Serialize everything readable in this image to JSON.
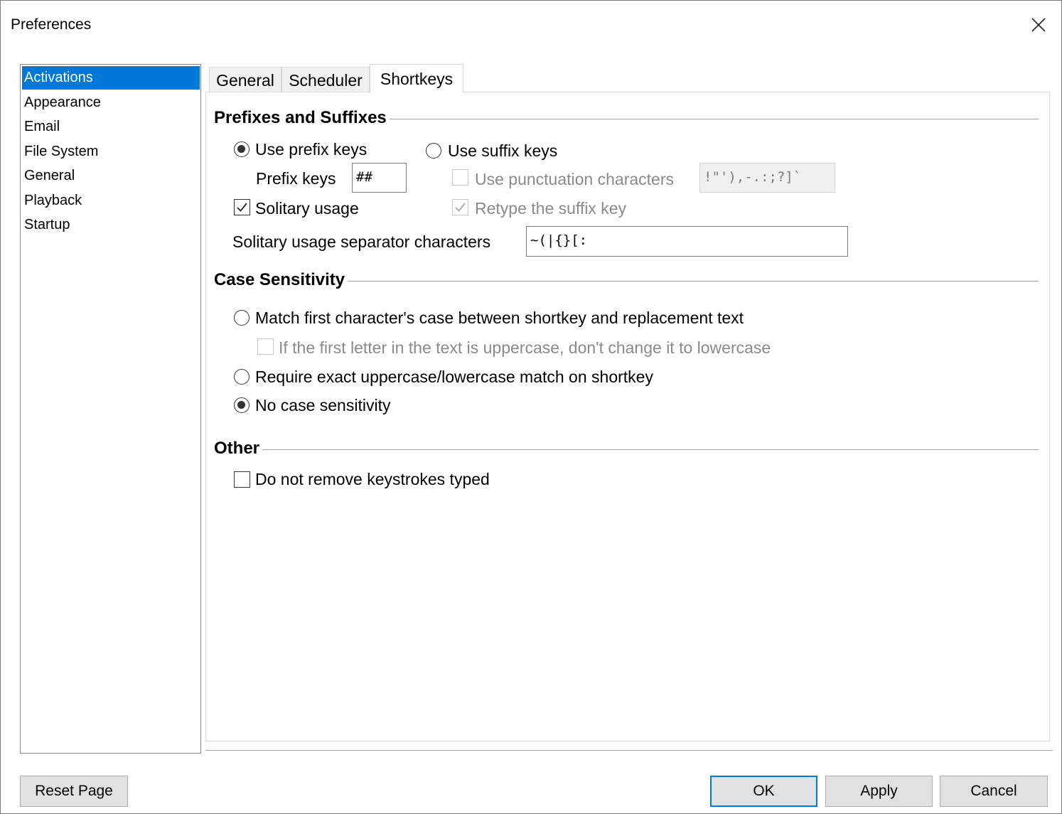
{
  "window": {
    "title": "Preferences"
  },
  "categories": [
    "Activations",
    "Appearance",
    "Email",
    "File System",
    "General",
    "Playback",
    "Startup"
  ],
  "selected_category": "Activations",
  "tabs": [
    "General",
    "Scheduler",
    "Shortkeys"
  ],
  "active_tab": "Shortkeys",
  "prefixes": {
    "title": "Prefixes and Suffixes",
    "use_prefix_label": "Use prefix keys",
    "use_prefix_selected": true,
    "use_suffix_label": "Use suffix keys",
    "use_suffix_selected": false,
    "prefix_keys_label": "Prefix keys",
    "prefix_keys_value": "##",
    "punctuation_label": "Use punctuation characters",
    "punctuation_value": "!\"'),-.:;?]`",
    "punctuation_checked": false,
    "solitary_label": "Solitary usage",
    "solitary_checked": true,
    "retype_label": "Retype the suffix key",
    "retype_checked": true,
    "separator_label": "Solitary usage separator characters",
    "separator_value": "~(|{}[:"
  },
  "case": {
    "title": "Case Sensitivity",
    "match_first_label": "Match first character's case between shortkey and replacement text",
    "match_first_selected": false,
    "first_upper_label": "If the first letter in the text is uppercase, don't change it to lowercase",
    "first_upper_checked": false,
    "exact_label": "Require exact uppercase/lowercase match on shortkey",
    "exact_selected": false,
    "none_label": "No case sensitivity",
    "none_selected": true
  },
  "other": {
    "title": "Other",
    "no_remove_label": "Do not remove keystrokes typed",
    "no_remove_checked": false
  },
  "buttons": {
    "reset": "Reset Page",
    "ok": "OK",
    "apply": "Apply",
    "cancel": "Cancel"
  }
}
